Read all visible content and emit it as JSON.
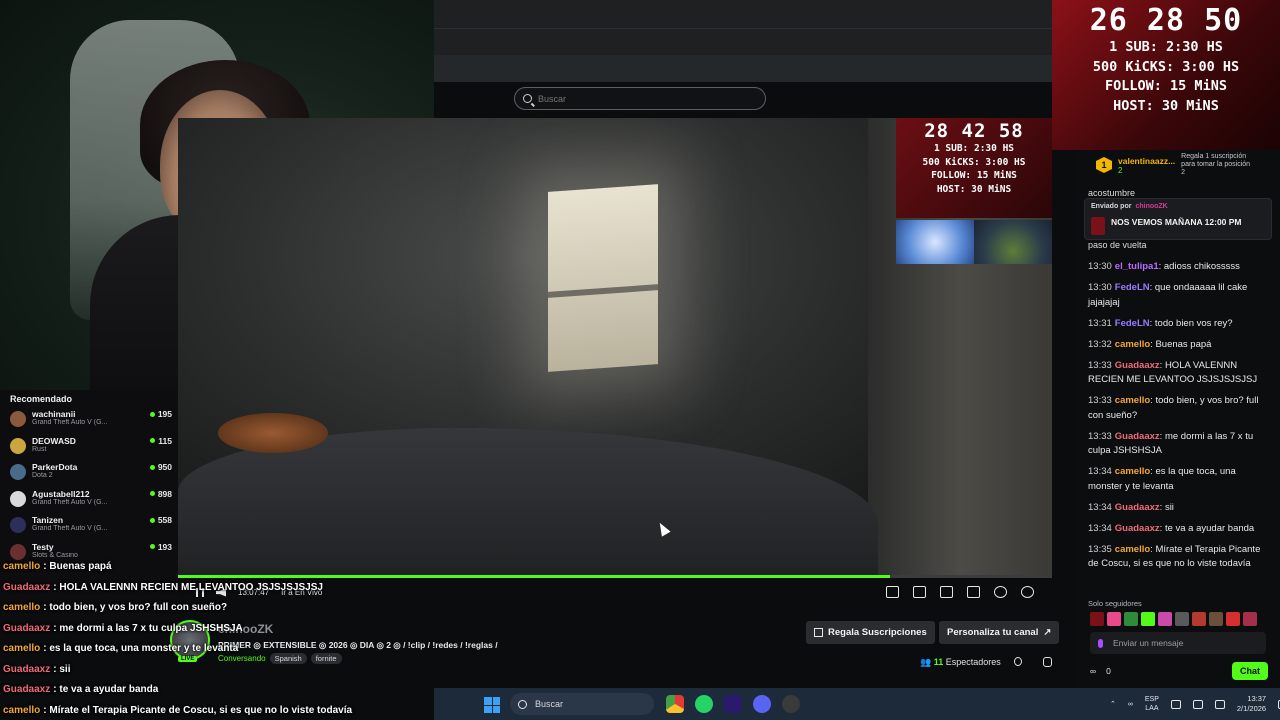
{
  "overlays": {
    "big": {
      "timer": "26 28 50",
      "goals": [
        "1 SUB: 2:30 HS",
        "500 KiCKS: 3:00 HS",
        "FOLLOW: 15 MiNS",
        "HOST: 30 MiNS"
      ]
    },
    "mini": {
      "timer": "28 42 58",
      "goals": [
        "1 SUB: 2:30 HS",
        "500 KiCKS: 3:00 HS",
        "FOLLOW: 15 MiNS",
        "HOST: 30 MiNS"
      ]
    }
  },
  "search": {
    "placeholder": "Buscar"
  },
  "player": {
    "time": "13:07:47",
    "live_link": "Ir a En Vivo",
    "progress": 0.815
  },
  "recommended": {
    "title": "Recomendado",
    "items": [
      {
        "name": "wachinanii",
        "game": "Grand Theft Auto V (G...",
        "viewers": "195",
        "color": "#8b5a3c"
      },
      {
        "name": "DEOWASD",
        "game": "Rust",
        "viewers": "115",
        "color": "#c9a640"
      },
      {
        "name": "ParkerDota",
        "game": "Dota 2",
        "viewers": "950",
        "color": "#4a6a8a"
      },
      {
        "name": "Agustabell212",
        "game": "Grand Theft Auto V (G...",
        "viewers": "898",
        "color": "#d9d9d9"
      },
      {
        "name": "Tanizen",
        "game": "Grand Theft Auto V (G...",
        "viewers": "558",
        "color": "#2e2e5a"
      },
      {
        "name": "Testy",
        "game": "Slots & Casino",
        "viewers": "193",
        "color": "#6a2f2f"
      }
    ]
  },
  "overlay_chat": [
    {
      "user": "camello",
      "color": "#f2a73a",
      "text": ": Buenas papá"
    },
    {
      "user": "Guadaaxz",
      "color": "#ef6b7a",
      "text": ": HOLA VALENNN RECIEN ME LEVANTOO JSJSJSJSJSJ"
    },
    {
      "user": "camello",
      "color": "#f2a73a",
      "text": ": todo bien, y vos bro? full con sueño?"
    },
    {
      "user": "Guadaaxz",
      "color": "#ef6b7a",
      "text": ": me dormi a las 7 x tu culpa JSHSHSJA"
    },
    {
      "user": "camello",
      "color": "#f2a73a",
      "text": ": es la que toca, una monster y te levanta"
    },
    {
      "user": "Guadaaxz",
      "color": "#ef6b7a",
      "text": ": sii"
    },
    {
      "user": "Guadaaxz",
      "color": "#ef6b7a",
      "text": ": te va a ayudar banda"
    },
    {
      "user": "camello",
      "color": "#f2a73a",
      "text": ": Mírate el Terapia Picante de Coscu, si es que no lo viste todavía"
    }
  ],
  "channel": {
    "name": "chinooZK",
    "title": "PRIMER ◎ EXTENSIBLE ◎ 2026 ◎ DIA ◎ 2 ◎ / !clip / !redes / !reglas /",
    "category": "Conversando",
    "tags": [
      "Spanish",
      "fornite"
    ],
    "live_label": "LIVE",
    "gift_button": "Regala Suscripciones",
    "customize_button": "Personaliza tu canal",
    "viewers_count": "11",
    "viewers_label": "Espectadores"
  },
  "chat": {
    "gift_leader": {
      "rank": "1",
      "user": "valentinaazz...",
      "count": "2",
      "cta": "Regala 1 suscripción para tomar la posición 2"
    },
    "peek_top": "acostumbre",
    "pinned": {
      "label": "Enviado por",
      "author": "chinooZK",
      "message": "NOS VEMOS MAÑANA 12:00 PM"
    },
    "peek_bottom": "paso de vuelta",
    "messages": [
      {
        "time": "13:30",
        "user": "el_tulipa1",
        "color": "#b86bff",
        "text": ": adioss chikosssss"
      },
      {
        "time": "13:30",
        "user": "FedeLN",
        "color": "#9b7bff",
        "text": ": que ondaaaaa lil cake jajajajaj"
      },
      {
        "time": "13:31",
        "user": "FedeLN",
        "color": "#9b7bff",
        "text": ": todo bien vos rey?"
      },
      {
        "time": "13:32",
        "user": "camello",
        "color": "#f2a73a",
        "text": ": Buenas papá"
      },
      {
        "time": "13:33",
        "user": "Guadaaxz",
        "color": "#ef6b7a",
        "text": ": HOLA VALENNN RECIEN ME LEVANTOO JSJSJSJSJSJ"
      },
      {
        "time": "13:33",
        "user": "camello",
        "color": "#f2a73a",
        "text": ": todo bien, y vos bro? full con sueño?"
      },
      {
        "time": "13:33",
        "user": "Guadaaxz",
        "color": "#ef6b7a",
        "text": ": me dormi a las 7 x tu culpa JSHSHSJA"
      },
      {
        "time": "13:34",
        "user": "camello",
        "color": "#f2a73a",
        "text": ": es la que toca, una monster y te levanta"
      },
      {
        "time": "13:34",
        "user": "Guadaaxz",
        "color": "#ef6b7a",
        "text": ": sii"
      },
      {
        "time": "13:34",
        "user": "Guadaaxz",
        "color": "#ef6b7a",
        "text": ": te va a ayudar banda"
      },
      {
        "time": "13:35",
        "user": "camello",
        "color": "#f2a73a",
        "text": ": Mírate el Terapia Picante de Coscu, si es que no lo viste todavía"
      }
    ],
    "followers_only": "Solo seguidores",
    "input_placeholder": "Enviar un mensaje",
    "infinity": "∞",
    "points": "0",
    "send_button": "Chat"
  },
  "taskbar": {
    "search_placeholder": "Buscar",
    "lang": "ESP",
    "lang_sub": "LAA",
    "time": "13:37",
    "date": "2/1/2026"
  }
}
